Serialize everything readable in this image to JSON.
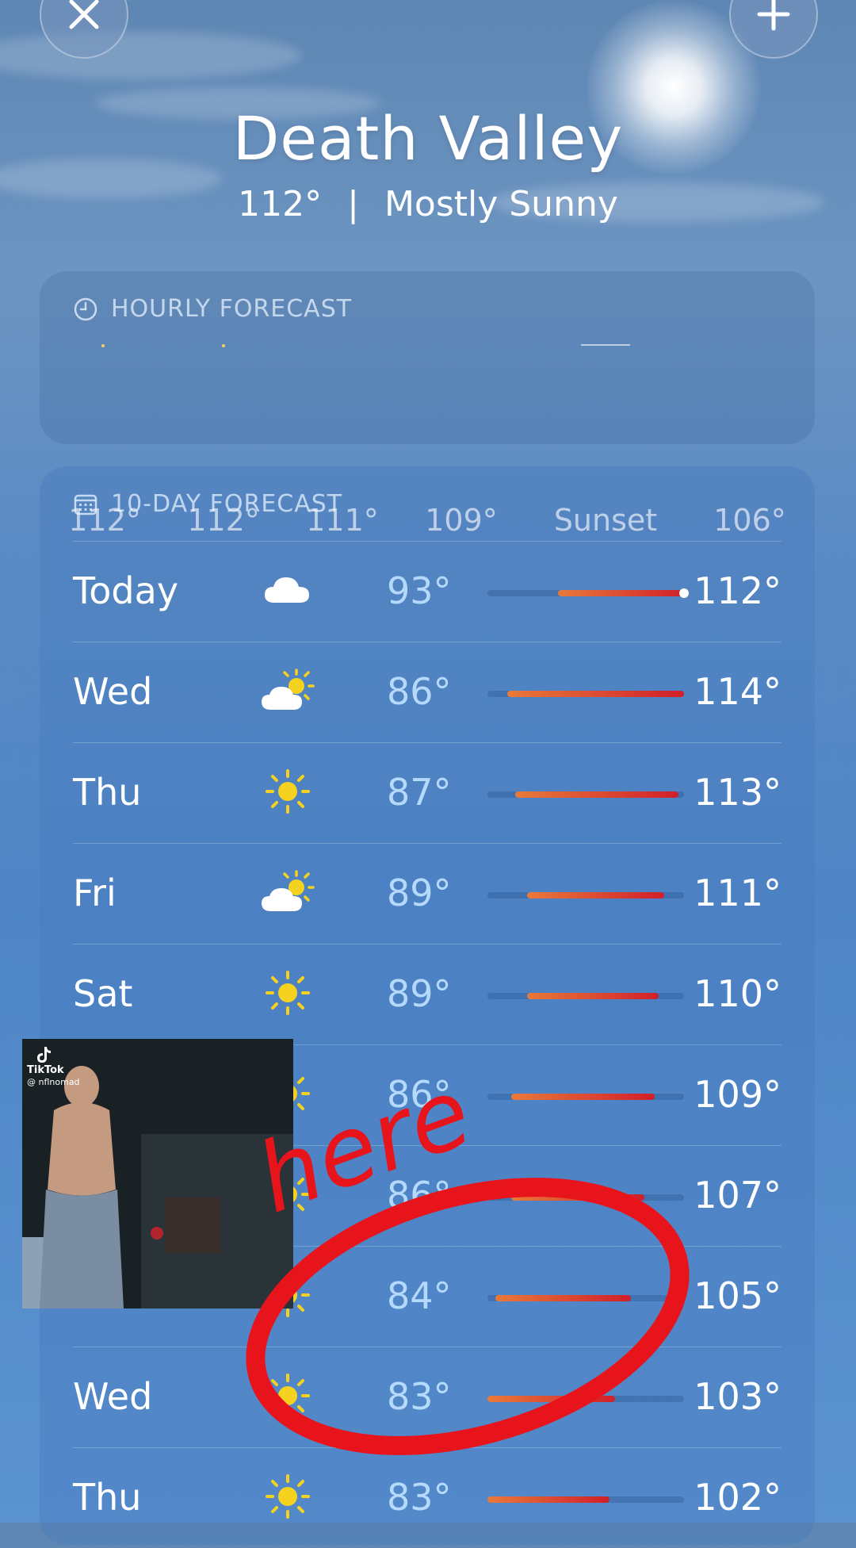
{
  "header": {
    "city": "Death Valley",
    "temp": "112°",
    "separator": "|",
    "condition": "Mostly Sunny"
  },
  "hourly": {
    "title": "HOURLY FORECAST",
    "items": [
      "112°",
      "112°",
      "111°",
      "109°",
      "Sunset",
      "106°"
    ]
  },
  "daily": {
    "title": "10-DAY FORECAST",
    "rows": [
      {
        "day": "Today",
        "icon": "cloud-icon",
        "low": "93°",
        "high": "112°",
        "bar_start": 0.36,
        "bar_end": 1.0,
        "current": 1.0
      },
      {
        "day": "Wed",
        "icon": "partly-sunny-icon",
        "low": "86°",
        "high": "114°",
        "bar_start": 0.1,
        "bar_end": 1.0
      },
      {
        "day": "Thu",
        "icon": "sun-icon",
        "low": "87°",
        "high": "113°",
        "bar_start": 0.14,
        "bar_end": 0.97
      },
      {
        "day": "Fri",
        "icon": "partly-sunny-icon",
        "low": "89°",
        "high": "111°",
        "bar_start": 0.2,
        "bar_end": 0.9
      },
      {
        "day": "Sat",
        "icon": "sun-icon",
        "low": "89°",
        "high": "110°",
        "bar_start": 0.2,
        "bar_end": 0.87
      },
      {
        "day": "",
        "icon": "sun-icon",
        "low": "86°",
        "high": "109°",
        "bar_start": 0.12,
        "bar_end": 0.85
      },
      {
        "day": "",
        "icon": "sun-icon",
        "low": "86°",
        "high": "107°",
        "bar_start": 0.12,
        "bar_end": 0.8
      },
      {
        "day": "",
        "icon": "sun-icon",
        "low": "84°",
        "high": "105°",
        "bar_start": 0.04,
        "bar_end": 0.73
      },
      {
        "day": "Wed",
        "icon": "sun-icon",
        "low": "83°",
        "high": "103°",
        "bar_start": 0.0,
        "bar_end": 0.65
      },
      {
        "day": "Thu",
        "icon": "sun-icon",
        "low": "83°",
        "high": "102°",
        "bar_start": 0.0,
        "bar_end": 0.62
      }
    ]
  },
  "annotation": {
    "text": "here",
    "color": "#e8141c"
  },
  "pip": {
    "brand": "TikTok",
    "handle": "@ nflnomad"
  },
  "colors": {
    "bar_warm": "#e87a3a",
    "bar_hot": "#d11f2a",
    "low_text": "#bfe1ff"
  }
}
